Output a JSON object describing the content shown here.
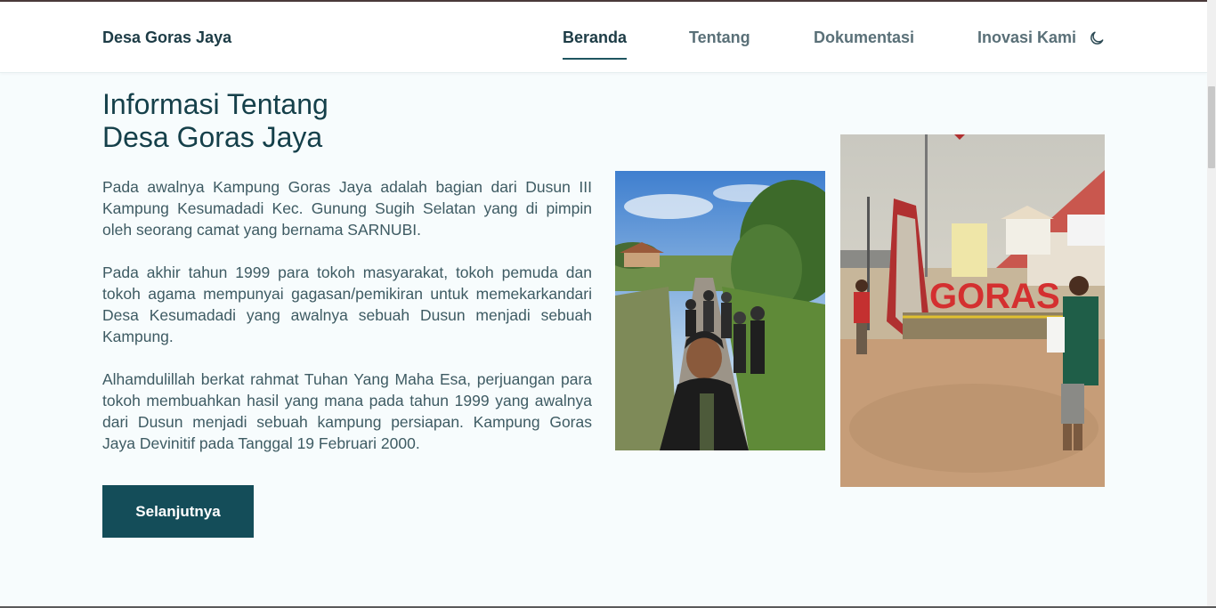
{
  "nav": {
    "brand": "Desa Goras Jaya",
    "links": [
      {
        "label": "Beranda",
        "active": true
      },
      {
        "label": "Tentang",
        "active": false
      },
      {
        "label": "Dokumentasi",
        "active": false
      },
      {
        "label": "Inovasi Kami",
        "active": false
      }
    ],
    "theme_toggle_icon": "moon-icon"
  },
  "section": {
    "heading_line1": "Informasi Tentang",
    "heading_line2": "Desa Goras Jaya",
    "paragraphs": [
      "Pada awalnya Kampung Goras Jaya adalah bagian dari Dusun III Kampung Kesumadadi Kec. Gunung Sugih Selatan yang di pimpin oleh seorang camat yang bernama SARNUBI.",
      "Pada akhir tahun 1999 para tokoh masyarakat, tokoh pemuda dan tokoh agama mempunyai gagasan/pemikiran untuk memekarkandari Desa Kesumadadi yang awalnya sebuah Dusun menjadi sebuah Kampung.",
      "Alhamdulillah berkat rahmat Tuhan Yang Maha Esa, perjuangan para tokoh membuahkan hasil yang mana pada tahun 1999 yang awalnya dari Dusun menjadi sebuah kampung persiapan. Kampung Goras Jaya Devinitif pada Tanggal 19 Februari 2000."
    ],
    "cta_label": "Selanjutnya"
  },
  "photos": {
    "photo1_sign_text": "",
    "photo2_sign_text": "GORAS"
  },
  "colors": {
    "brand_dark": "#144d59",
    "heading": "#15404a",
    "body_text": "#3e5b63",
    "background": "#f7fcfd"
  }
}
